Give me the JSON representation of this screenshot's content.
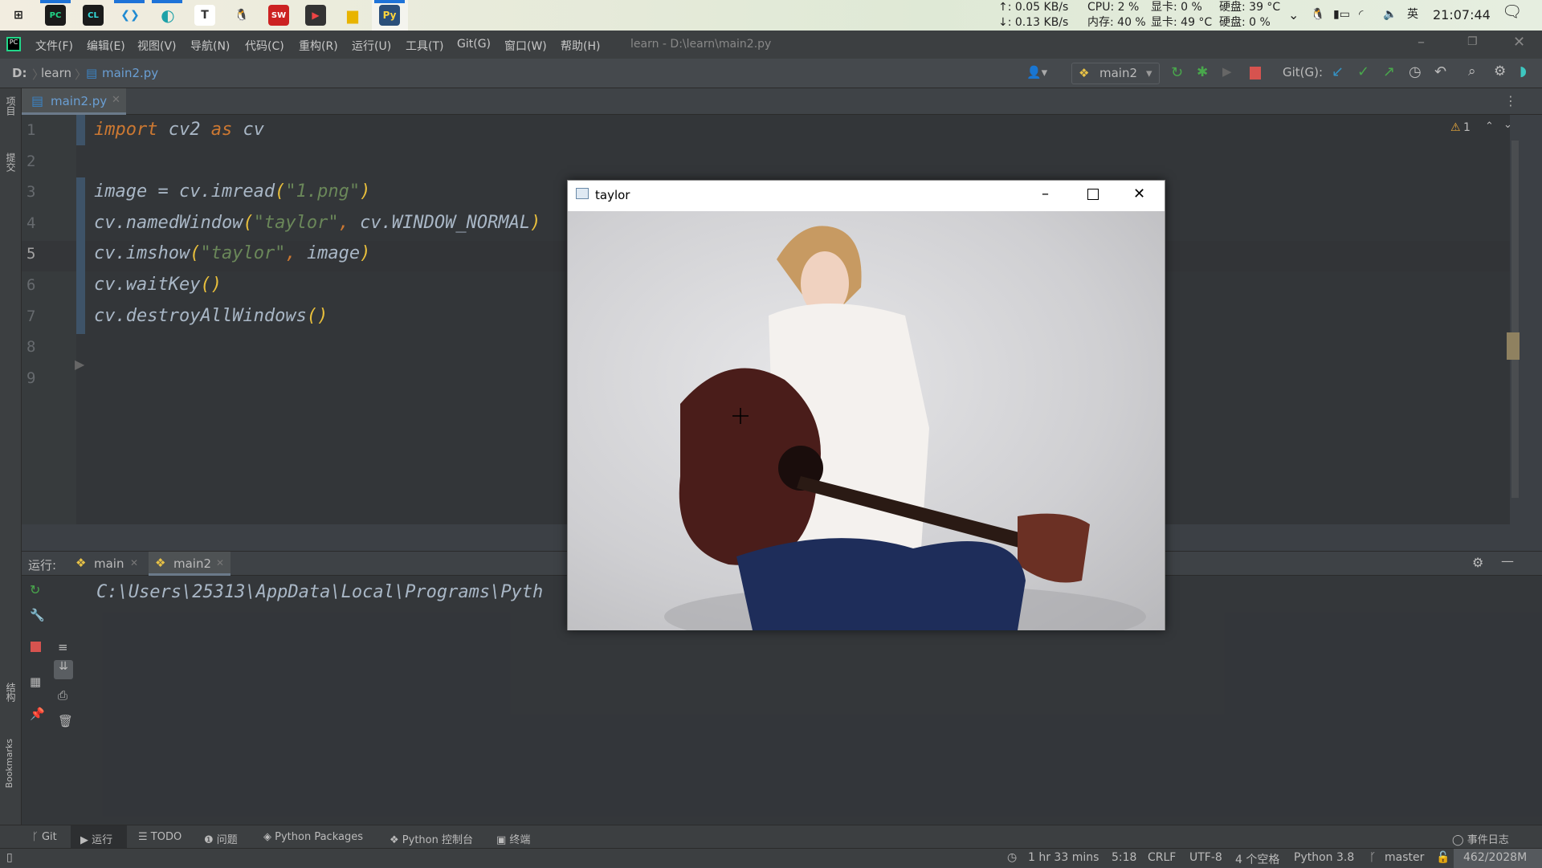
{
  "taskbar": {
    "apps": [
      "windows-start",
      "pycharm",
      "clion",
      "vscode",
      "edge",
      "typora",
      "qq",
      "solidworks",
      "terminal",
      "file-explorer",
      "python"
    ],
    "net_up": "↑: 0.05 KB/s",
    "net_down": "↓: 0.13 KB/s",
    "cpu": "CPU: 2 %",
    "gpu_load": "显卡: 0 %",
    "disk_temp": "硬盘: 39 °C",
    "mem": "内存: 40 %",
    "gpu_temp": "显卡: 49 °C",
    "disk_load": "硬盘: 0 %",
    "ime": "英",
    "clock": "21:07:44"
  },
  "menubar": {
    "items": [
      "文件(F)",
      "编辑(E)",
      "视图(V)",
      "导航(N)",
      "代码(C)",
      "重构(R)",
      "运行(U)",
      "工具(T)",
      "Git(G)",
      "窗口(W)",
      "帮助(H)"
    ],
    "title": "learn - D:\\learn\\main2.py"
  },
  "navbar": {
    "breadcrumb": [
      "D:",
      "learn",
      "main2.py"
    ],
    "run_config": "main2",
    "git_label": "Git(G):"
  },
  "editor": {
    "tab": "main2.py",
    "warnings": "1",
    "line_numbers": [
      "1",
      "2",
      "3",
      "4",
      "5",
      "6",
      "7",
      "8",
      "9"
    ],
    "current_line": 5,
    "lines": [
      [
        {
          "t": "import",
          "c": "kw"
        },
        {
          "t": " cv2 "
        },
        {
          "t": "as",
          "c": "kw"
        },
        {
          "t": " cv"
        }
      ],
      [],
      [
        {
          "t": "image = cv.imread"
        },
        {
          "t": "(",
          "c": "par"
        },
        {
          "t": "\"1.png\"",
          "c": "str"
        },
        {
          "t": ")",
          "c": "par"
        }
      ],
      [
        {
          "t": "cv.namedWindow"
        },
        {
          "t": "(",
          "c": "par"
        },
        {
          "t": "\"taylor\"",
          "c": "str"
        },
        {
          "t": ", ",
          "c": "kw"
        },
        {
          "t": "cv.WINDOW_NORMAL"
        },
        {
          "t": ")",
          "c": "par"
        }
      ],
      [
        {
          "t": "cv.imshow"
        },
        {
          "t": "(",
          "c": "par"
        },
        {
          "t": "\"taylor\"",
          "c": "str"
        },
        {
          "t": ", ",
          "c": "kw"
        },
        {
          "t": "image"
        },
        {
          "t": ")",
          "c": "par"
        }
      ],
      [
        {
          "t": "cv.waitKey"
        },
        {
          "t": "()",
          "c": "par"
        }
      ],
      [
        {
          "t": "cv.destroyAllWindows"
        },
        {
          "t": "()",
          "c": "par"
        }
      ],
      [],
      []
    ]
  },
  "left_strip": {
    "project": "项目",
    "commit": "提交",
    "structure": "结构",
    "bookmarks": "Bookmarks"
  },
  "run_panel": {
    "label": "运行:",
    "tabs": [
      "main",
      "main2"
    ],
    "active_tab": 1,
    "output": "C:\\Users\\25313\\AppData\\Local\\Programs\\Pyth"
  },
  "tool_tabs": [
    "Git",
    "运行",
    "TODO",
    "问题",
    "Python Packages",
    "Python 控制台",
    "终端"
  ],
  "event_log": "事件日志",
  "status": {
    "time": "1 hr 33 mins",
    "position": "5:18",
    "line_sep": "CRLF",
    "encoding": "UTF-8",
    "indent": "4 个空格",
    "interpreter": "Python 3.8",
    "branch": "master",
    "memory": "462/2028M"
  },
  "cv_window": {
    "title": "taylor"
  }
}
